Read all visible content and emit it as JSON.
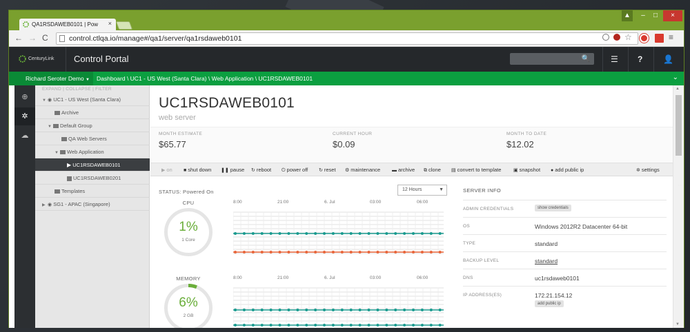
{
  "browser": {
    "tab_title": "QA1RSDAWEB0101 | Pow",
    "tab_close": "×",
    "url": "control.ctlqa.io/manage#/qa1/server/qa1rsdaweb0101",
    "window_min": "–",
    "window_max": "□",
    "window_close": "×"
  },
  "header": {
    "logo_text": "CenturyLink",
    "portal_title": "Control Portal"
  },
  "greenbar": {
    "account": "Richard Seroter Demo",
    "breadcrumb": "Dashboard \\ UC1 - US West (Santa Clara) \\ Web Application \\ UC1RSDAWEB0101"
  },
  "tree": {
    "header": "EXPAND | COLLAPSE | FILTER",
    "items": [
      {
        "label": "UC1 - US West (Santa Clara)"
      },
      {
        "label": "Archive"
      },
      {
        "label": "Default Group"
      },
      {
        "label": "QA Web Servers"
      },
      {
        "label": "Web Application"
      },
      {
        "label": "UC1RSDAWEB0101"
      },
      {
        "label": "UC1RSDAWEB0201"
      },
      {
        "label": "Templates"
      },
      {
        "label": "SG1 - APAC (Singapore)"
      }
    ]
  },
  "server": {
    "name": "UC1RSDAWEB0101",
    "description": "web server"
  },
  "costs": {
    "month_estimate_label": "MONTH ESTIMATE",
    "month_estimate_value": "$65.77",
    "current_hour_label": "CURRENT HOUR",
    "current_hour_value": "$0.09",
    "month_to_date_label": "MONTH TO DATE",
    "month_to_date_value": "$12.02"
  },
  "actions": {
    "on": "on",
    "shutdown": "shut down",
    "pause": "pause",
    "reboot": "reboot",
    "power_off": "power off",
    "reset": "reset",
    "maintenance": "maintenance",
    "archive": "archive",
    "clone": "clone",
    "convert": "convert to template",
    "snapshot": "snapshot",
    "add_public_ip": "add public ip",
    "settings": "settings"
  },
  "monitor": {
    "status": "STATUS: Powered On",
    "range": "12 Hours",
    "cpu_label": "CPU",
    "cpu_value": "1%",
    "cpu_sub": "1 Core",
    "memory_label": "MEMORY",
    "memory_value": "6%",
    "memory_sub": "2 GB",
    "memory_fraction": 0.06,
    "time_ticks": [
      "8:00",
      "21:00",
      "6. Jul",
      "03:00",
      "06:00"
    ]
  },
  "server_info": {
    "title": "SERVER INFO",
    "admin_label": "ADMIN CREDENTIALS",
    "admin_button": "show credentials",
    "os_label": "OS",
    "os_value": "Windows 2012R2 Datacenter 64-bit",
    "type_label": "TYPE",
    "type_value": "standard",
    "backup_label": "BACKUP LEVEL",
    "backup_value": "standard",
    "dns_label": "DNS",
    "dns_value": "uc1rsdaweb0101",
    "ip_label": "IP ADDRESS(ES)",
    "ip_value": "172.21.154.12",
    "ip_button": "add public ip"
  },
  "colors": {
    "green": "#0b9f40",
    "teal_series": "#1a9b8f",
    "orange_series": "#e8653a",
    "gauge_green": "#6aae3a"
  }
}
